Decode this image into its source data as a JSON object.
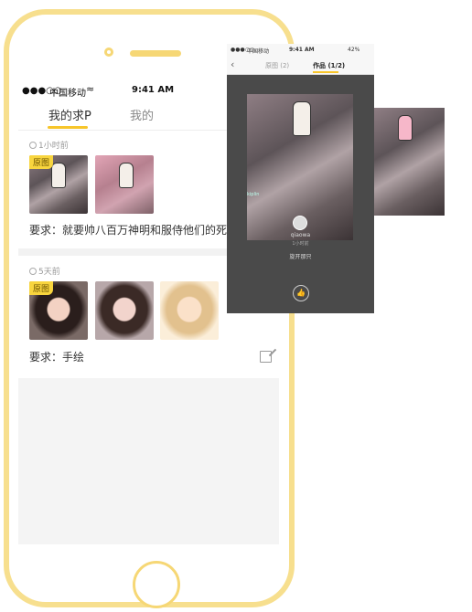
{
  "status_bar": {
    "carrier": "中国移动",
    "time": "9:41 AM"
  },
  "tabs": {
    "active": "我的求P",
    "other": "我的"
  },
  "cards": [
    {
      "time_ago": "1小时前",
      "badge": "原图",
      "requirement": "要求：就要帅八百万神明和服侍他们的死灵"
    },
    {
      "time_ago": "5天前",
      "badge": "原图",
      "requirement": "要求：手绘"
    }
  ],
  "overlay": {
    "status_carrier": "中国移动",
    "status_time": "9:41 AM",
    "status_battery": "42%",
    "nav_original": "原图",
    "nav_original_count": "(2)",
    "nav_works": "作品",
    "nav_works_count": "(1/2)",
    "username": "qiaowa",
    "user_time": "1小时前",
    "comment": "旋开那只",
    "watermark": "kiplin"
  },
  "colors": {
    "phone_frame": "#f7df8e",
    "accent": "#f7c52a",
    "badge": "#f8d53e"
  },
  "icons": [
    "wifi-icon",
    "clock-icon",
    "edit-icon",
    "back-icon",
    "thumbs-up-icon"
  ]
}
